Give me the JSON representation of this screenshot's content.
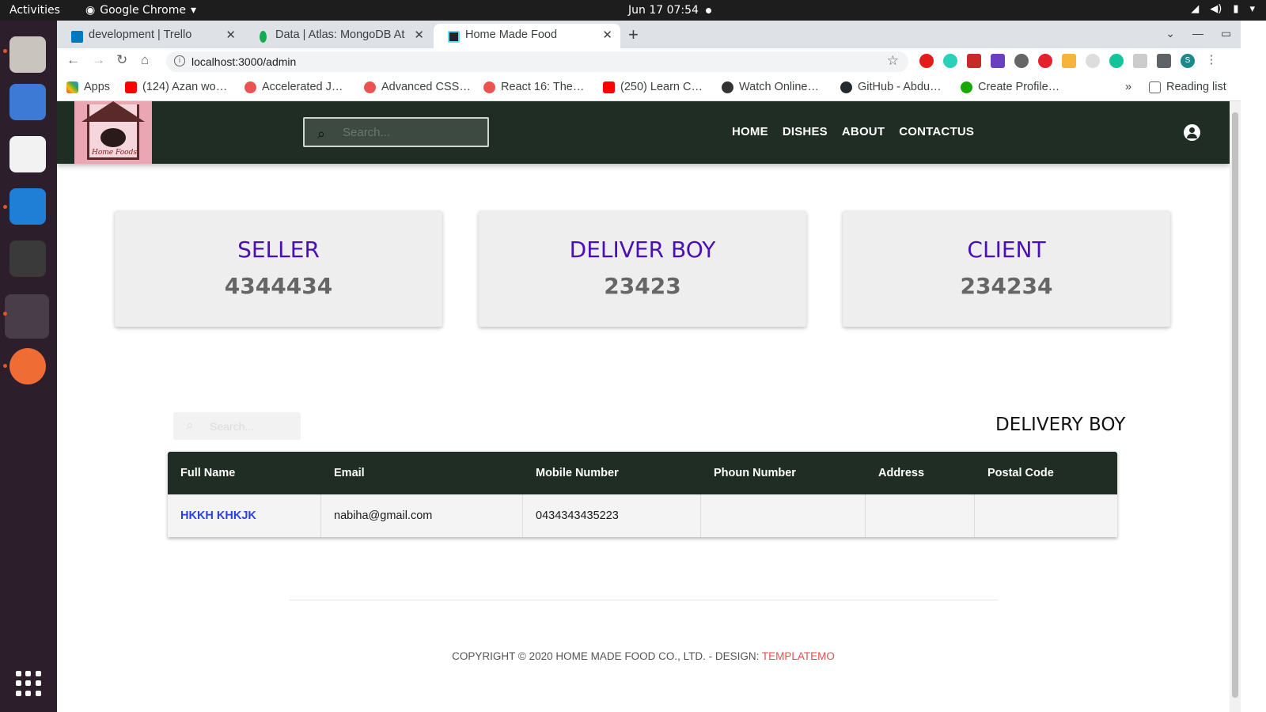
{
  "os": {
    "activities": "Activities",
    "app": "Google Chrome",
    "clock": "Jun 17  07:54"
  },
  "browser": {
    "tabs": [
      {
        "label": "development | Trello",
        "favicon_color": "#0079bf"
      },
      {
        "label": "Data | Atlas: MongoDB At",
        "favicon_color": "#13aa52"
      },
      {
        "label": "Home Made Food",
        "favicon_color": "#61dafb"
      }
    ],
    "url": "localhost:3000/admin",
    "bookmarks": [
      {
        "label": "Apps",
        "icon": "apps-grid-icon"
      },
      {
        "label": "(124) Azan wo…",
        "icon": "youtube-icon"
      },
      {
        "label": "Accelerated J…",
        "icon": "udemy-icon"
      },
      {
        "label": "Advanced CSS…",
        "icon": "udemy-icon"
      },
      {
        "label": "React 16: The…",
        "icon": "udemy-icon"
      },
      {
        "label": "(250) Learn C…",
        "icon": "youtube-icon"
      },
      {
        "label": "Watch Online…",
        "icon": "film-icon"
      },
      {
        "label": "GitHub - Abdu…",
        "icon": "github-icon"
      },
      {
        "label": "Create Profile…",
        "icon": "upwork-icon"
      }
    ],
    "more": "»",
    "reading_list": "Reading list",
    "profile_initial": "S"
  },
  "site": {
    "search_placeholder": "Search...",
    "menu": [
      "HOME",
      "DISHES",
      "ABOUT",
      "CONTACTUS"
    ],
    "logo_text": "Home Foods"
  },
  "stats": [
    {
      "title": "SELLER",
      "value": "4344434"
    },
    {
      "title": "DELIVER BOY",
      "value": "23423"
    },
    {
      "title": "CLIENT",
      "value": "234234"
    }
  ],
  "table": {
    "search_placeholder": "Search...",
    "title": "DELIVERY BOY",
    "columns": [
      "Full Name",
      "Email",
      "Mobile Number",
      "Phoun Number",
      "Address",
      "Postal Code"
    ],
    "rows": [
      [
        "HKKH KHKJK",
        "nabiha@gmail.com",
        "0434343435223",
        "",
        "",
        ""
      ]
    ]
  },
  "footer": {
    "text": "COPYRIGHT © 2020 HOME MADE FOOD CO., LTD. - DESIGN: ",
    "link": "TEMPLATEMO"
  }
}
